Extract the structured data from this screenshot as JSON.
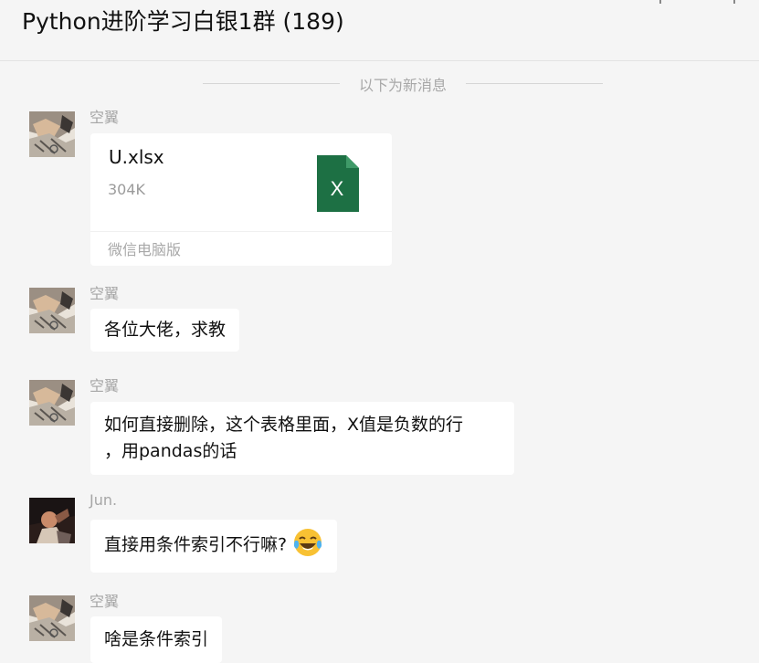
{
  "header": {
    "title": "Python进阶学习白银1群 (189)"
  },
  "divider": {
    "text": "以下为新消息"
  },
  "messages": [
    {
      "sender": "空翼",
      "type": "file",
      "file": {
        "name": "U.xlsx",
        "size": "304K",
        "source": "微信电脑版",
        "icon_letter": "X",
        "icon_color": "#1d7044"
      }
    },
    {
      "sender": "空翼",
      "type": "text",
      "lines": [
        "各位大佬，求教"
      ]
    },
    {
      "sender": "空翼",
      "type": "text",
      "lines": [
        "如何直接删除，这个表格里面，X值是负数的行",
        "，用pandas的话"
      ]
    },
    {
      "sender": "Jun.",
      "type": "text",
      "lines": [
        "直接用条件索引不行嘛?"
      ],
      "emoji": "tears-of-joy-emoji"
    },
    {
      "sender": "空翼",
      "type": "text",
      "lines": [
        "啥是条件索引"
      ]
    }
  ],
  "colors": {
    "background": "#f5f5f5",
    "bubble": "#ffffff",
    "sender_name": "#a6a6a6",
    "excel_green": "#1d7044"
  }
}
